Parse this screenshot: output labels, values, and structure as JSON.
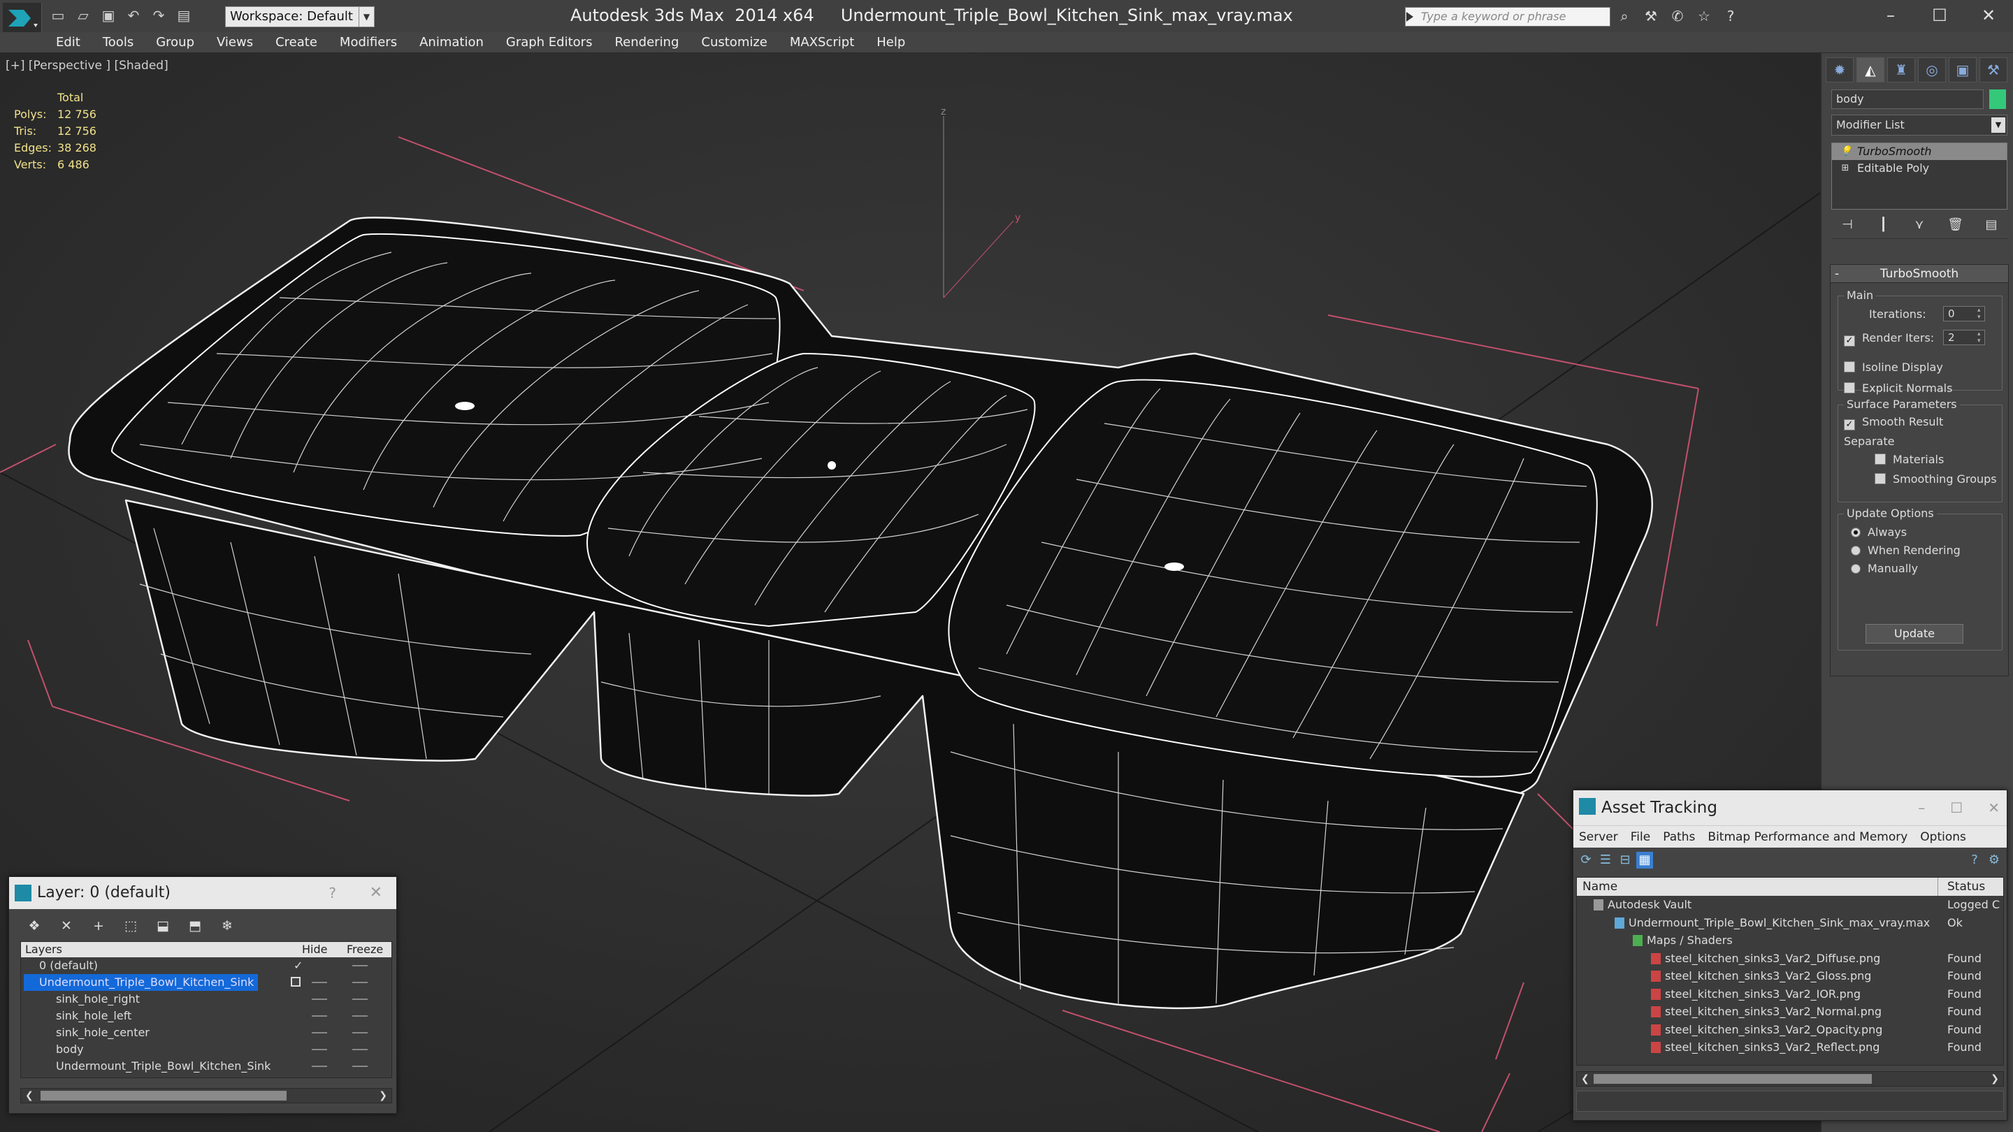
{
  "titlebar": {
    "workspace": "Workspace: Default",
    "title": "Autodesk 3ds Max  2014 x64     Undermount_Triple_Bowl_Kitchen_Sink_max_vray.max",
    "search_placeholder": "Type a keyword or phrase"
  },
  "menu": [
    "Edit",
    "Tools",
    "Group",
    "Views",
    "Create",
    "Modifiers",
    "Animation",
    "Graph Editors",
    "Rendering",
    "Customize",
    "MAXScript",
    "Help"
  ],
  "viewport": {
    "label": "[+] [Perspective ] [Shaded]",
    "stats": {
      "header": "Total",
      "rows": [
        {
          "k": "Polys:",
          "v": "12 756"
        },
        {
          "k": "Tris:",
          "v": "12 756"
        },
        {
          "k": "Edges:",
          "v": "38 268"
        },
        {
          "k": "Verts:",
          "v": "6 486"
        }
      ]
    },
    "axis_labels": {
      "z": "z",
      "y": "y"
    }
  },
  "command_panel": {
    "object_name": "body",
    "object_color": "#34c87a",
    "modifier_list": "Modifier List",
    "stack": [
      "TurboSmooth",
      "Editable Poly"
    ],
    "rollout": {
      "title": "TurboSmooth",
      "main": "Main",
      "iterations_label": "Iterations:",
      "iterations_value": "0",
      "render_iters_label": "Render Iters:",
      "render_iters_value": "2",
      "isoline": "Isoline Display",
      "explicit_normals": "Explicit Normals",
      "surface_params": "Surface Parameters",
      "smooth_result": "Smooth Result",
      "separate": "Separate",
      "materials": "Materials",
      "smoothing_groups": "Smoothing Groups",
      "update_options": "Update Options",
      "always": "Always",
      "when_rendering": "When Rendering",
      "manually": "Manually",
      "update": "Update"
    }
  },
  "layer_dialog": {
    "title": "Layer: 0 (default)",
    "help": "?",
    "columns": {
      "layers": "Layers",
      "hide": "Hide",
      "freeze": "Freeze"
    },
    "rows": [
      {
        "name": "0 (default)",
        "indent": 0
      },
      {
        "name": "Undermount_Triple_Bowl_Kitchen_Sink",
        "indent": 0
      },
      {
        "name": "sink_hole_right",
        "indent": 1
      },
      {
        "name": "sink_hole_left",
        "indent": 1
      },
      {
        "name": "sink_hole_center",
        "indent": 1
      },
      {
        "name": "body",
        "indent": 1
      },
      {
        "name": "Undermount_Triple_Bowl_Kitchen_Sink",
        "indent": 1
      }
    ]
  },
  "asset_tracking": {
    "title": "Asset Tracking",
    "menu": [
      "Server",
      "File",
      "Paths",
      "Bitmap Performance and Memory",
      "Options"
    ],
    "columns": {
      "name": "Name",
      "status": "Status"
    },
    "rows": [
      {
        "name": "Autodesk Vault",
        "status": "Logged C",
        "indent": 0
      },
      {
        "name": "Undermount_Triple_Bowl_Kitchen_Sink_max_vray.max",
        "status": "Ok",
        "indent": 1
      },
      {
        "name": "Maps / Shaders",
        "status": "",
        "indent": 2
      },
      {
        "name": "steel_kitchen_sinks3_Var2_Diffuse.png",
        "status": "Found",
        "indent": 3
      },
      {
        "name": "steel_kitchen_sinks3_Var2_Gloss.png",
        "status": "Found",
        "indent": 3
      },
      {
        "name": "steel_kitchen_sinks3_Var2_IOR.png",
        "status": "Found",
        "indent": 3
      },
      {
        "name": "steel_kitchen_sinks3_Var2_Normal.png",
        "status": "Found",
        "indent": 3
      },
      {
        "name": "steel_kitchen_sinks3_Var2_Opacity.png",
        "status": "Found",
        "indent": 3
      },
      {
        "name": "steel_kitchen_sinks3_Var2_Reflect.png",
        "status": "Found",
        "indent": 3
      }
    ]
  }
}
